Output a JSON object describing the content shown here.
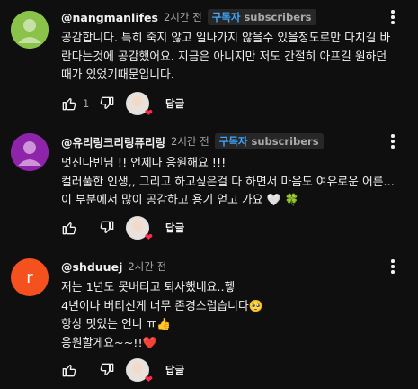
{
  "comments": [
    {
      "avatar_color": "#8bc34a",
      "author": "@nangmanlifes",
      "time": "2시간 전",
      "badge_member": "구독자",
      "badge_sub": "subscribers",
      "lines": [
        "공감합니다. 특히 죽지 않고 일나가지 않을수 있을정도로만 다치길 바",
        "란다는것에 공감했어요. 지금은 아니지만 저도 간절히 아프길 원하던",
        "때가 있었기때문입니다."
      ],
      "likes": "1",
      "reply_label": "답글"
    },
    {
      "avatar_color": "#8e24aa",
      "author": "@유리링크리링퓨리링",
      "time": "2시간 전",
      "badge_member": "구독자",
      "badge_sub": "subscribers",
      "lines": [
        "멋진다빈님 !! 언제나 응원해요 !!!",
        "컬러풀한 인생,, 그리고 하고싶은걸 다 하면서 마음도 여유로운 어른...",
        "이 부분에서 많이 공감하고 용기 얻고 가요 🤍 🍀"
      ],
      "likes": "",
      "reply_label": "답글"
    },
    {
      "avatar_color": "#f4511e",
      "avatar_letter": "r",
      "author": "@shduuej",
      "time": "2시간 전",
      "lines": [
        "저는 1년도 못버티고 퇴사했네요..헿",
        "4년이나 버티신게 너무 존경스럽습니다🥺",
        " 항상 멋있는 언니 ㅠ👍",
        " 응원할게요~~!!❤️"
      ],
      "likes": "",
      "reply_label": "답글"
    }
  ]
}
